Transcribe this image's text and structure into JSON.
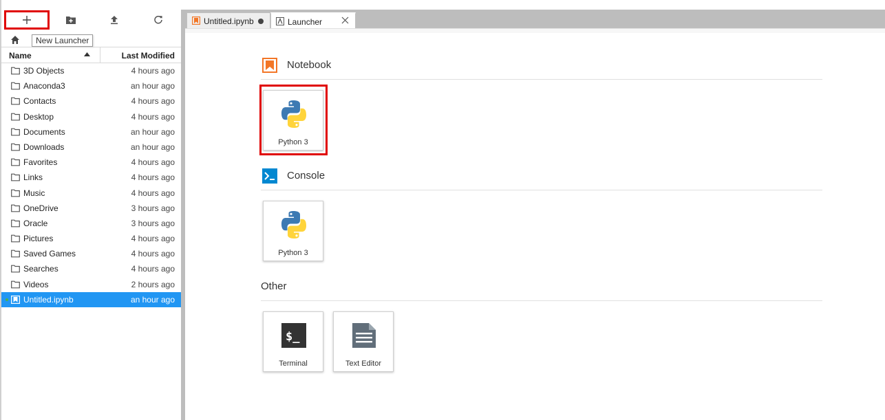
{
  "toolbar": {
    "new_launcher_tooltip": "New Launcher"
  },
  "file_browser": {
    "columns": {
      "name": "Name",
      "modified": "Last Modified"
    },
    "files": [
      {
        "name": "3D Objects",
        "modified": "4 hours ago",
        "type": "folder"
      },
      {
        "name": "Anaconda3",
        "modified": "an hour ago",
        "type": "folder"
      },
      {
        "name": "Contacts",
        "modified": "4 hours ago",
        "type": "folder"
      },
      {
        "name": "Desktop",
        "modified": "4 hours ago",
        "type": "folder"
      },
      {
        "name": "Documents",
        "modified": "an hour ago",
        "type": "folder"
      },
      {
        "name": "Downloads",
        "modified": "an hour ago",
        "type": "folder"
      },
      {
        "name": "Favorites",
        "modified": "4 hours ago",
        "type": "folder"
      },
      {
        "name": "Links",
        "modified": "4 hours ago",
        "type": "folder"
      },
      {
        "name": "Music",
        "modified": "4 hours ago",
        "type": "folder"
      },
      {
        "name": "OneDrive",
        "modified": "3 hours ago",
        "type": "folder"
      },
      {
        "name": "Oracle",
        "modified": "3 hours ago",
        "type": "folder"
      },
      {
        "name": "Pictures",
        "modified": "4 hours ago",
        "type": "folder"
      },
      {
        "name": "Saved Games",
        "modified": "4 hours ago",
        "type": "folder"
      },
      {
        "name": "Searches",
        "modified": "4 hours ago",
        "type": "folder"
      },
      {
        "name": "Videos",
        "modified": "2 hours ago",
        "type": "folder"
      },
      {
        "name": "Untitled.ipynb",
        "modified": "an hour ago",
        "type": "notebook",
        "selected": true,
        "running": true
      }
    ]
  },
  "tabs": [
    {
      "label": "Untitled.ipynb",
      "icon": "notebook-icon",
      "dirty": true
    },
    {
      "label": "Launcher",
      "icon": "launcher-icon",
      "active": true
    }
  ],
  "launcher": {
    "sections": {
      "notebook": {
        "title": "Notebook",
        "cards": [
          {
            "label": "Python 3",
            "icon": "python-icon"
          }
        ]
      },
      "console": {
        "title": "Console",
        "cards": [
          {
            "label": "Python 3",
            "icon": "python-icon"
          }
        ]
      },
      "other": {
        "title": "Other",
        "cards": [
          {
            "label": "Terminal",
            "icon": "terminal-icon"
          },
          {
            "label": "Text Editor",
            "icon": "text-editor-icon"
          }
        ]
      }
    }
  },
  "colors": {
    "accent_selected": "#2196f3",
    "highlight_box": "#e00000",
    "notebook_orange": "#f37626",
    "console_blue": "#0288d1"
  }
}
